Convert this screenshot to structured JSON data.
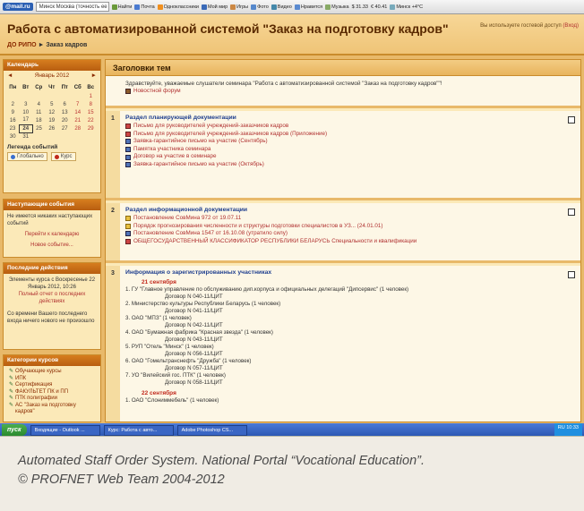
{
  "browser": {
    "logo": "@mail.ru",
    "address": "Минск Москва (точность ее",
    "find_label": "Найти",
    "bookmarks": [
      "Почта",
      "Одноклассники",
      "Мой мир",
      "Игры",
      "Фото",
      "Видео",
      "Нравится",
      "Музыка",
      "$ 31.33",
      "€ 40.41",
      "Минск +4°C"
    ]
  },
  "header": {
    "title": "Работа с автоматизированной системой \"Заказ на подготовку кадров\"",
    "logged_text": "Вы используете гостевой доступ",
    "login_link": "(Вход)",
    "breadcrumb_root": "ДО РИПО",
    "breadcrumb_sep": "►",
    "breadcrumb_current": "Заказ кадров"
  },
  "calendar": {
    "title": "Календарь",
    "prev": "◄",
    "month": "Январь 2012",
    "next": "►",
    "weekdays": [
      "Пн",
      "Вт",
      "Ср",
      "Чт",
      "Пт",
      "Сб",
      "Вс"
    ],
    "weeks": [
      [
        "",
        "",
        "",
        "",
        "",
        "",
        "1"
      ],
      [
        "2",
        "3",
        "4",
        "5",
        "6",
        "7",
        "8"
      ],
      [
        "9",
        "10",
        "11",
        "12",
        "13",
        "14",
        "15"
      ],
      [
        "16",
        "17",
        "18",
        "19",
        "20",
        "21",
        "22"
      ],
      [
        "23",
        "24",
        "25",
        "26",
        "27",
        "28",
        "29"
      ],
      [
        "30",
        "31",
        "",
        "",
        "",
        "",
        ""
      ]
    ],
    "today": "24",
    "legend_title": "Легенда событий",
    "legend_global": "Глобально",
    "legend_course": "Курс",
    "legend_global_color": "#3a6fd0",
    "legend_course_color": "#c0281c"
  },
  "upcoming": {
    "title": "Наступающие события",
    "text": "Не имеется никаких наступающих событий",
    "calendar_link": "Перейти к календарю",
    "new_event_link": "Новое событие..."
  },
  "recent": {
    "title": "Последние действия",
    "since": "Элементы курса с Воскресенье 22 Январь 2012, 10:26",
    "full_report": "Полный отчет о последних действиях",
    "nothing": "Со времени Вашего последнего входа ничего нового не произошло"
  },
  "categories": {
    "title": "Категории курсов",
    "items": [
      "Обучающие курсы",
      "ИПК",
      "Сертификация",
      "ФАКУЛЬТЕТ ПК и ПП",
      "ПТК полиграфии",
      "АС \"Заказ на подготовку кадров\""
    ]
  },
  "main": {
    "heading": "Заголовки тем",
    "welcome": "Здравствуйте, уважаемые слушатели семинара \"Работа с автоматизированной системой \"Заказ на подготовку кадров\"\"!",
    "news_forum": "Новостной форум",
    "sections": [
      {
        "num": "1",
        "title": "Раздел планирующей документации",
        "items": [
          "Письмо для руководителей учреждений-заказчиков кадров",
          "Письмо для руководителей учреждений-заказчиков кадров (Приложение)",
          "Заявка-гарантийное письмо на участие (Сентябрь)",
          "Памятка участника семинара",
          "Договор на участие в семинаре",
          "Заявка-гарантийное письмо на участие (Октябрь)"
        ]
      },
      {
        "num": "2",
        "title": "Раздел информационной документации",
        "items": [
          "Постановление СовМина 972 от 19.07.11",
          "Порядок прогнозирования численности и структуры подготовки специалистов в УЗ... (24.01.01)",
          "Постановление СовМина 1547 от 16.10.08 (утратило силу)",
          "ОБЩЕГОСУДАРСТВЕННЫЙ КЛАССИФИКАТОР РЕСПУБЛИКИ БЕЛАРУСЬ Специальности и квалификации"
        ]
      },
      {
        "num": "3",
        "title": "Информация о зарегистрированных участниках",
        "dates": [
          {
            "date": "21 сентября",
            "entries": [
              {
                "text": "1. ГУ \"Главное управление по обслуживанию дип.корпуса и официальных делегаций \"Дипсервис\" (1 человек)",
                "contract": "Договор N 040-11/ЦИТ"
              },
              {
                "text": "2. Министерство культуры Республики Беларусь (1 человек)",
                "contract": "Договор N 041-11/ЦИТ"
              },
              {
                "text": "3. ОАО \"МПЗ\" (1 человек)",
                "contract": "Договор N 042-11/ЦИТ"
              },
              {
                "text": "4. ОАО \"Бумажная фабрика \"Красная звезда\" (1 человек)",
                "contract": "Договор N 043-11/ЦИТ"
              },
              {
                "text": "5. РУП \"Отель \"Минск\" (1 человек)",
                "contract": "Договор N 056-11/ЦИТ"
              },
              {
                "text": "6. ОАО \"Гомельтранснефть \"Дружба\" (1 человек)",
                "contract": "Договор N 057-11/ЦИТ"
              },
              {
                "text": "7. УО \"Вилейский гос. ПТК\" (1 человек)",
                "contract": "Договор N 058-11/ЦИТ"
              }
            ]
          },
          {
            "date": "22 сентября",
            "entries": [
              {
                "text": "1. ОАО \"Слониммебель\" (1 человек)",
                "contract": ""
              }
            ]
          }
        ]
      }
    ]
  },
  "taskbar": {
    "start": "пуск",
    "tasks": [
      "Входящие - Outlook ...",
      "Курс: Работа с авто...",
      "Adobe Photoshop CS..."
    ],
    "tray": "RU  10:33"
  },
  "caption": {
    "line1": "Automated Staff Order System. National Portal “Vocational Education”.",
    "line2": "© PROFNET Web Team 2004-2012"
  }
}
